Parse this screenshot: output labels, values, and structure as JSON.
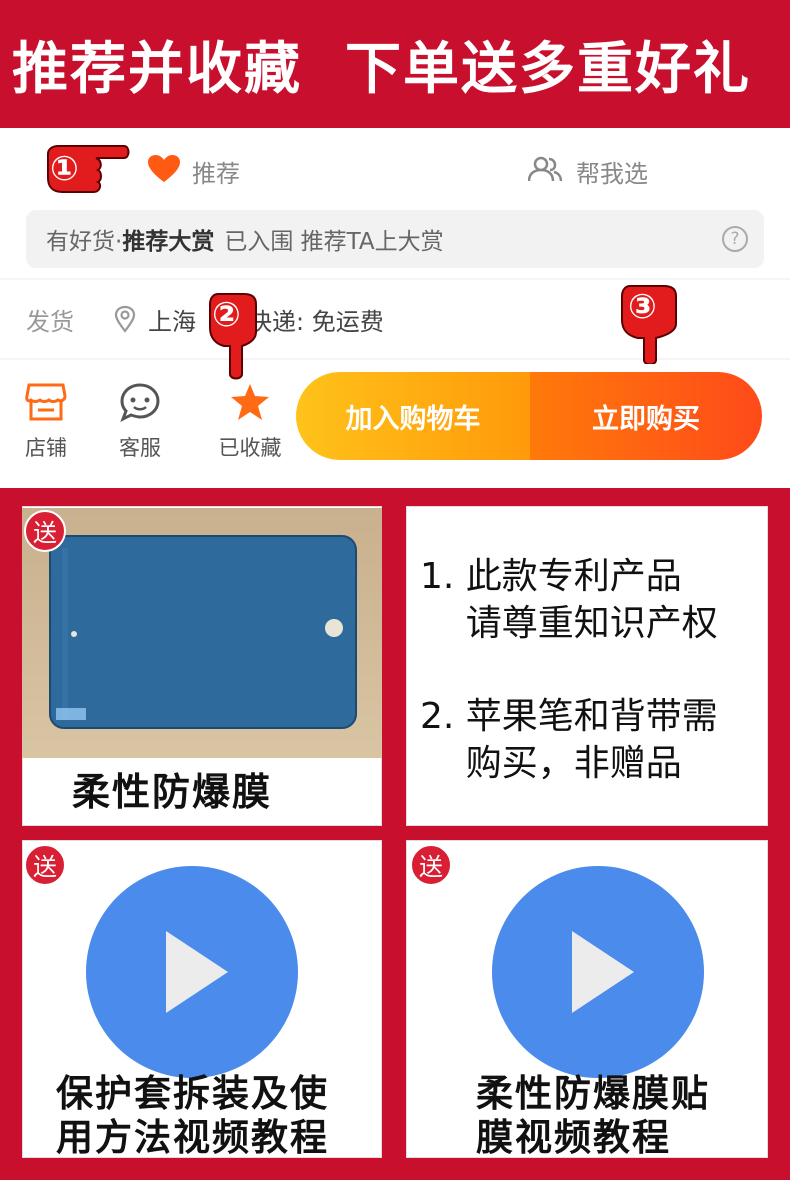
{
  "banner": {
    "text": "推荐并收藏  下单送多重好礼"
  },
  "screenshot": {
    "recommend_label": "推荐",
    "help_label": "帮我选",
    "award": {
      "prefix": "有好货·",
      "bold": "推荐大赏",
      "suffix": "已入围 推荐TA上大赏",
      "help_icon": "?"
    },
    "shipping": {
      "label": "发货",
      "location": "上海",
      "method": "快递: 免运费"
    },
    "tabs": [
      {
        "label": "店铺",
        "icon": "store-icon"
      },
      {
        "label": "客服",
        "icon": "chat-icon"
      },
      {
        "label": "已收藏",
        "icon": "star-icon"
      }
    ],
    "add_to_cart": "加入购物车",
    "buy_now": "立即购买",
    "steps": [
      "①",
      "②",
      "③"
    ]
  },
  "panels": [
    {
      "badge": "送",
      "caption": "柔性防爆膜"
    },
    {
      "notes": "1. 此款专利产品\n    请尊重知识产权\n\n2. 苹果笔和背带需\n    购买，非赠品"
    },
    {
      "badge": "送",
      "caption": "保护套拆装及使\n用方法视频教程"
    },
    {
      "badge": "送",
      "caption": "柔性防爆膜贴\n膜视频教程"
    }
  ],
  "colors": {
    "brand_red": "#c8102e",
    "play_blue": "#4a8bec",
    "cart_orange": "#ffb214",
    "buy_orange": "#ff5a14"
  }
}
